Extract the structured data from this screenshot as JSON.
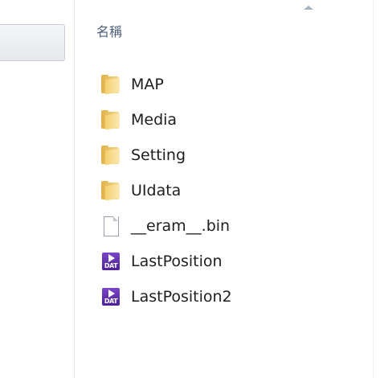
{
  "header": {
    "name_column": "名稱"
  },
  "files": [
    {
      "name": "MAP",
      "icon": "folder-icon"
    },
    {
      "name": "Media",
      "icon": "folder-icon"
    },
    {
      "name": "Setting",
      "icon": "folder-icon"
    },
    {
      "name": "UIdata",
      "icon": "folder-icon"
    },
    {
      "name": "__eram__.bin",
      "icon": "file-icon"
    },
    {
      "name": "LastPosition",
      "icon": "dat-file-icon",
      "icon_label": "DAT"
    },
    {
      "name": "LastPosition2",
      "icon": "dat-file-icon",
      "icon_label": "DAT"
    }
  ],
  "colors": {
    "header_text": "#4c607a",
    "folder": "#f4d170",
    "dat_icon": "#6a35b8"
  }
}
